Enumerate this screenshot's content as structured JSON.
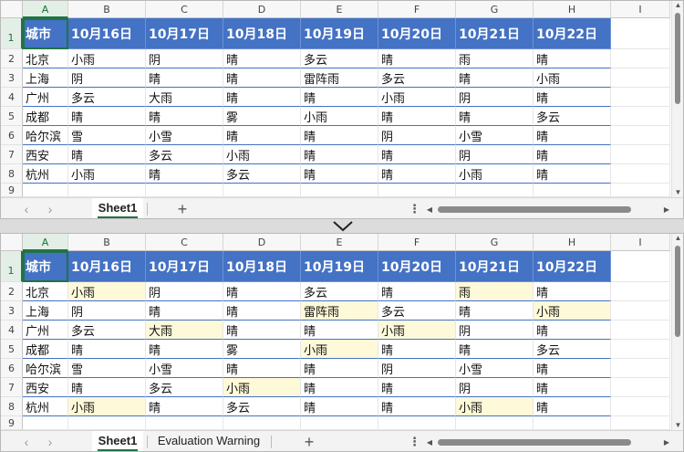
{
  "columns": [
    "A",
    "B",
    "C",
    "D",
    "E",
    "F",
    "G",
    "H",
    "I"
  ],
  "rows": [
    "1",
    "2",
    "3",
    "4",
    "5",
    "6",
    "7",
    "8",
    "9"
  ],
  "table": {
    "header": [
      "城市",
      "10月16日",
      "10月17日",
      "10月18日",
      "10月19日",
      "10月20日",
      "10月21日",
      "10月22日"
    ],
    "body": [
      [
        "北京",
        "小雨",
        "阴",
        "晴",
        "多云",
        "晴",
        "雨",
        "晴"
      ],
      [
        "上海",
        "阴",
        "晴",
        "晴",
        "雷阵雨",
        "多云",
        "晴",
        "小雨"
      ],
      [
        "广州",
        "多云",
        "大雨",
        "晴",
        "晴",
        "小雨",
        "阴",
        "晴"
      ],
      [
        "成都",
        "晴",
        "晴",
        "雾",
        "小雨",
        "晴",
        "晴",
        "多云"
      ],
      [
        "哈尔滨",
        "雪",
        "小雪",
        "晴",
        "晴",
        "阴",
        "小雪",
        "晴"
      ],
      [
        "西安",
        "晴",
        "多云",
        "小雨",
        "晴",
        "晴",
        "阴",
        "晴"
      ],
      [
        "杭州",
        "小雨",
        "晴",
        "多云",
        "晴",
        "晴",
        "小雨",
        "晴"
      ]
    ]
  },
  "highlighted_cells_after": [
    [
      0,
      1
    ],
    [
      0,
      6
    ],
    [
      1,
      4
    ],
    [
      1,
      7
    ],
    [
      2,
      2
    ],
    [
      2,
      5
    ],
    [
      3,
      4
    ],
    [
      5,
      3
    ],
    [
      6,
      1
    ],
    [
      6,
      6
    ]
  ],
  "sheets_before": [
    "Sheet1"
  ],
  "sheets_after": [
    "Sheet1",
    "Evaluation Warning"
  ],
  "icons": {
    "add_sheet": "+",
    "more": "⋮",
    "prev_sheet": "‹",
    "next_sheet": "›",
    "scroll_left": "◀",
    "scroll_right": "▶",
    "scroll_up": "▲",
    "scroll_down": "▼"
  },
  "colors": {
    "header_fill": "#4472c4",
    "highlight_fill": "#fdf9d9",
    "selection": "#217346",
    "divider": "#dcdcdc"
  }
}
